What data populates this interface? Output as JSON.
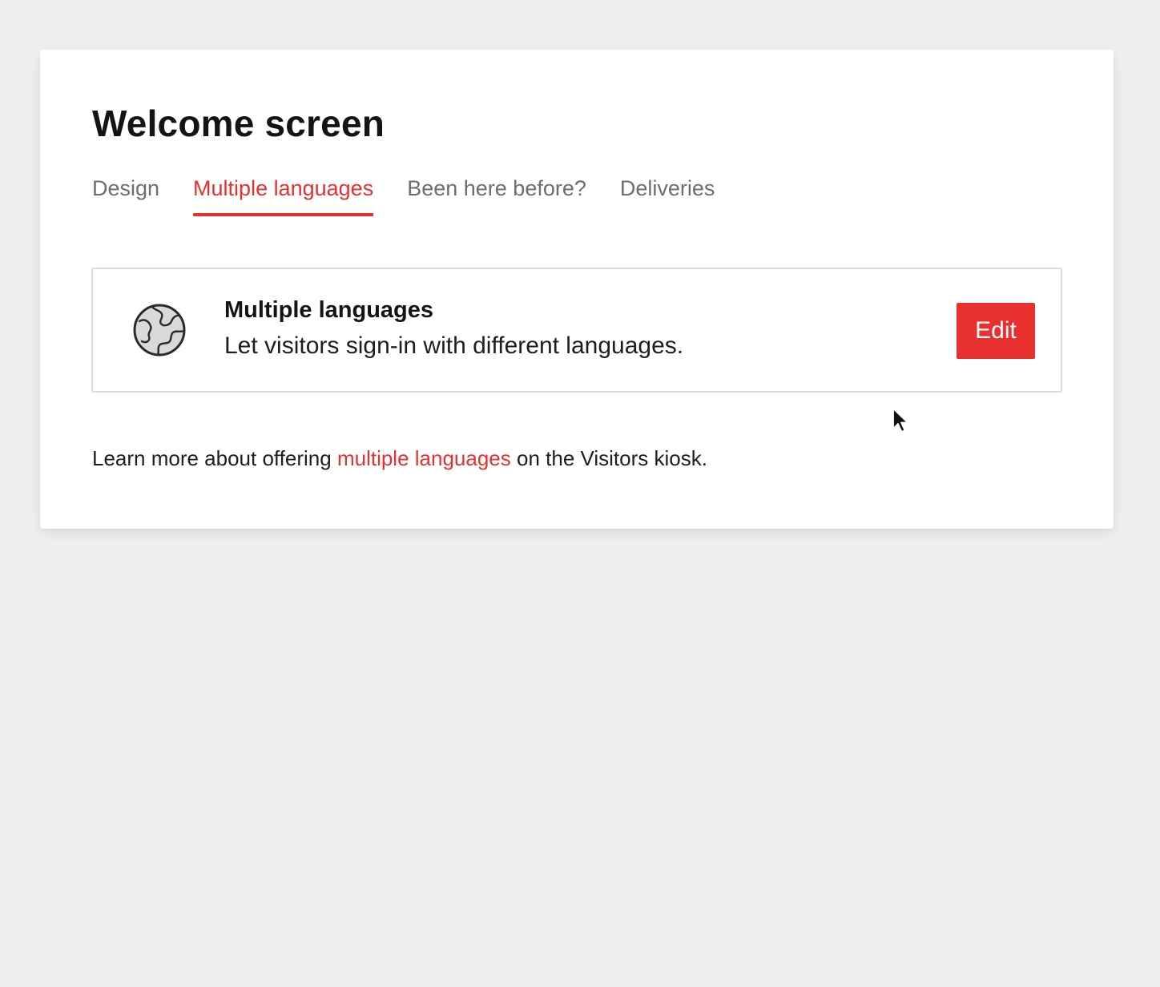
{
  "page": {
    "title": "Welcome screen"
  },
  "tabs": [
    {
      "label": "Design",
      "active": false
    },
    {
      "label": "Multiple languages",
      "active": true
    },
    {
      "label": "Been here before?",
      "active": false
    },
    {
      "label": "Deliveries",
      "active": false
    }
  ],
  "feature": {
    "icon": "globe-icon",
    "title": "Multiple languages",
    "description": "Let visitors sign-in with different languages.",
    "edit_label": "Edit"
  },
  "learn_more": {
    "prefix": "Learn more about offering ",
    "link_text": "multiple languages",
    "suffix": " on the Visitors kiosk."
  },
  "colors": {
    "accent": "#e8302e",
    "background": "#efefef",
    "card": "#ffffff",
    "tab_inactive": "#6e6e6e"
  }
}
